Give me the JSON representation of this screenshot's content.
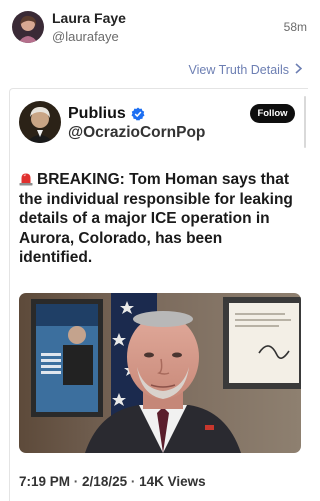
{
  "outer_post": {
    "display_name": "Laura Faye",
    "handle": "@laurafaye",
    "time_ago": "58m",
    "details_link": "View Truth Details",
    "details_link_icon": "chevron-right-icon"
  },
  "embedded_post": {
    "display_name": "Publius",
    "handle": "@OcrazioCornPop",
    "verified_icon": "verified-check-icon",
    "follow_label": "Follow",
    "text": {
      "icon": "siren-icon",
      "body": "BREAKING:  Tom Homan says that the individual responsible for leaking details of a major ICE operation in Aurora, Colorado, has been identified."
    },
    "media_description_icon": "news-video-still",
    "timestamp": "7:19 PM",
    "date": "2/18/25",
    "views": "14K Views"
  },
  "colors": {
    "link": "#6d7fb3",
    "verified": "#1d6ff2",
    "siren": "#e0302e",
    "follow_bg": "#0e0e0e"
  }
}
